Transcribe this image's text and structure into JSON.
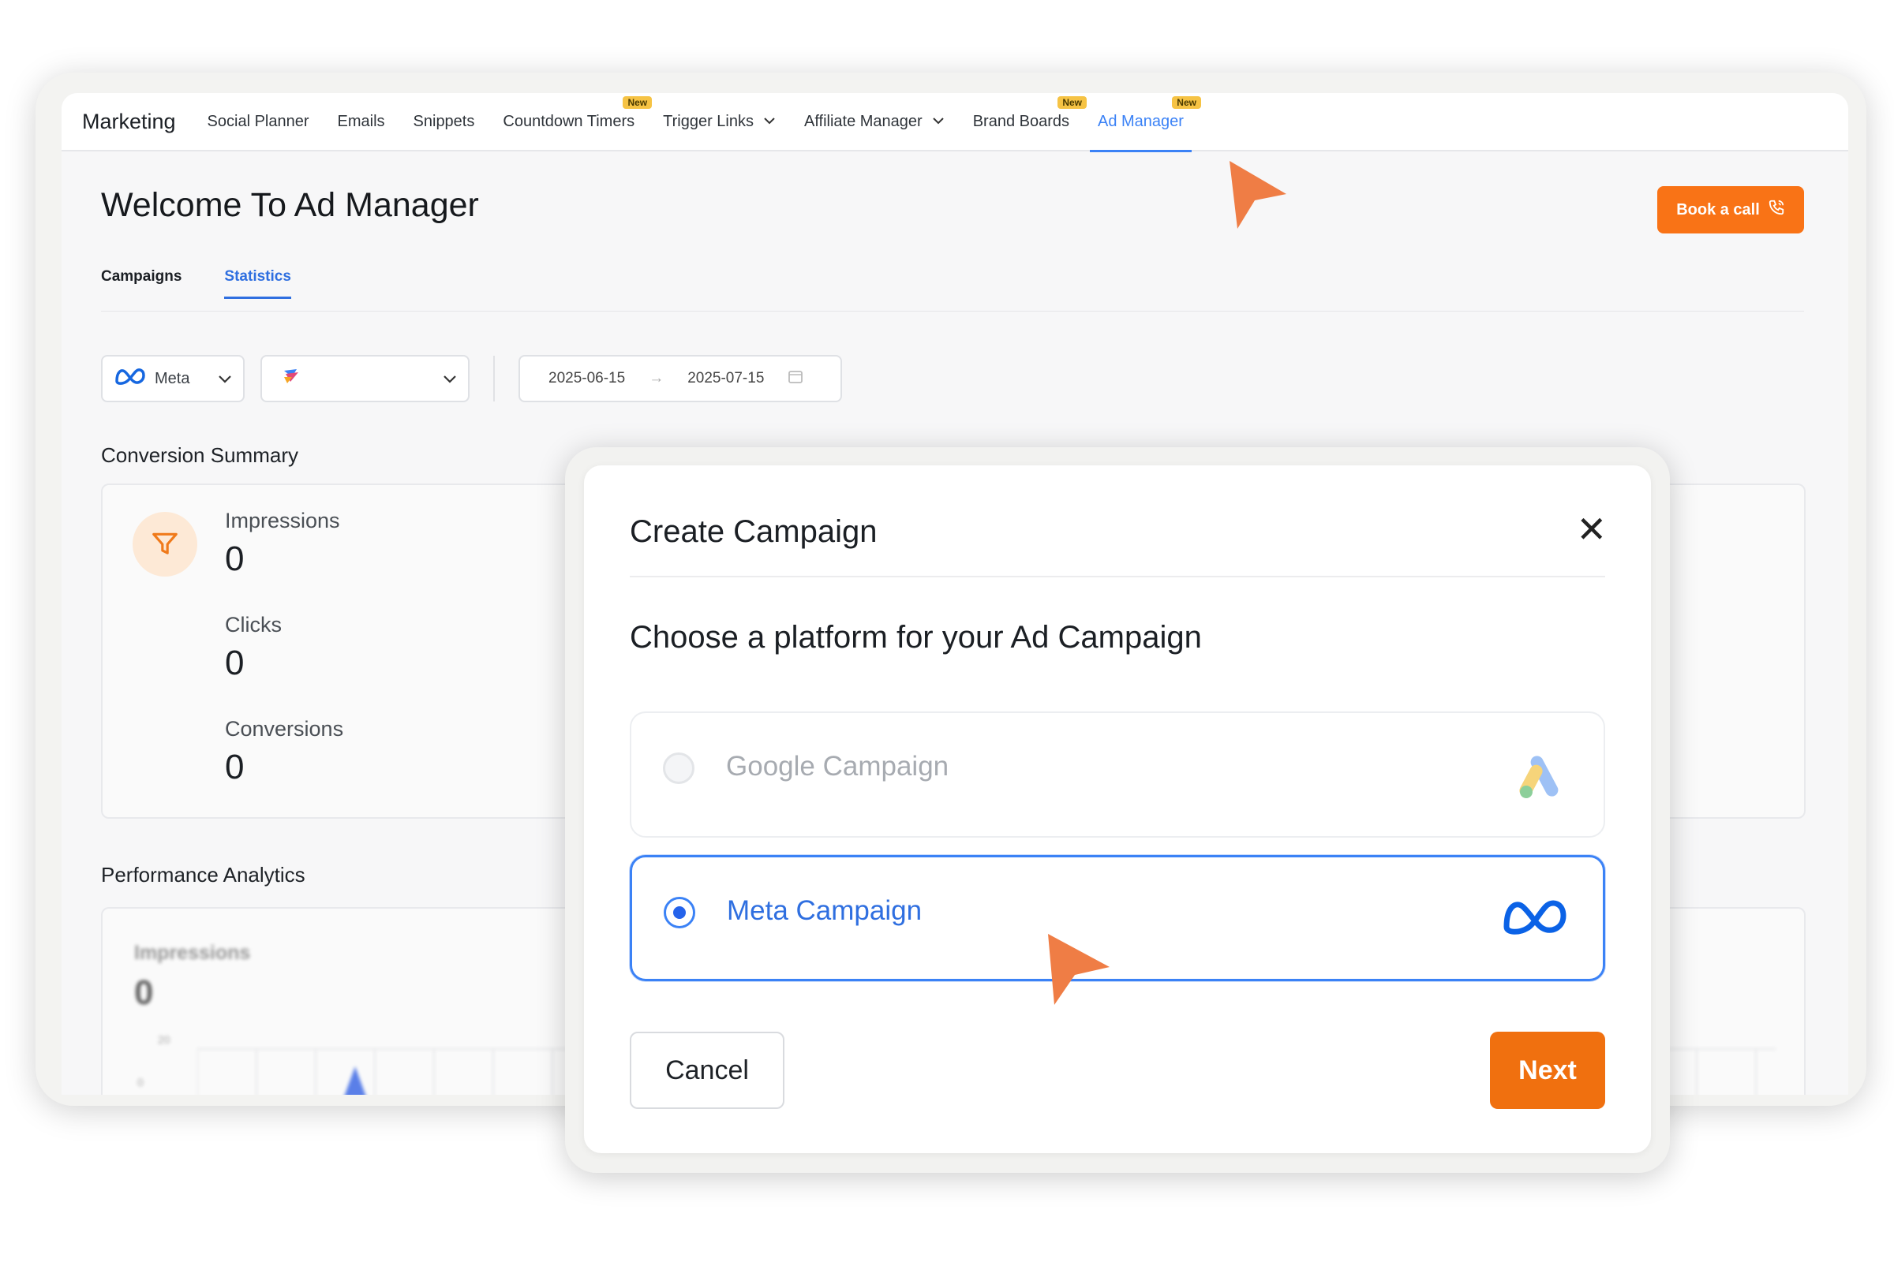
{
  "nav": {
    "brand": "Marketing",
    "items": [
      {
        "label": "Social Planner"
      },
      {
        "label": "Emails"
      },
      {
        "label": "Snippets"
      },
      {
        "label": "Countdown Timers",
        "badge": "New"
      },
      {
        "label": "Trigger Links",
        "dropdown": true
      },
      {
        "label": "Affiliate Manager",
        "dropdown": true
      },
      {
        "label": "Brand Boards",
        "badge": "New"
      },
      {
        "label": "Ad Manager",
        "badge": "New",
        "active": true
      }
    ]
  },
  "page": {
    "title": "Welcome To Ad Manager",
    "book_call": "Book a call",
    "tabs": [
      {
        "label": "Campaigns"
      },
      {
        "label": "Statistics",
        "active": true
      }
    ]
  },
  "filters": {
    "platform": "Meta",
    "account": "",
    "date_from": "2025-06-15",
    "date_to": "2025-07-15",
    "arrow": "→"
  },
  "summary": {
    "title": "Conversion Summary",
    "metrics": [
      {
        "label": "Impressions",
        "value": "0"
      },
      {
        "label": "Clicks",
        "value": "0"
      },
      {
        "label": "Conversions",
        "value": "0"
      }
    ]
  },
  "performance": {
    "title": "Performance Analytics",
    "metric_label": "Impressions",
    "metric_value": "0",
    "tick_top": "20",
    "tick_bottom": "0"
  },
  "modal": {
    "title": "Create Campaign",
    "close": "✕",
    "subtitle": "Choose a platform for your Ad Campaign",
    "options": [
      {
        "label": "Google Campaign",
        "selected": false,
        "icon": "google-ads-icon"
      },
      {
        "label": "Meta Campaign",
        "selected": true,
        "icon": "meta-icon"
      }
    ],
    "cancel": "Cancel",
    "next": "Next"
  },
  "colors": {
    "accent": "#3b82f6",
    "orange": "#f0700f",
    "cursor": "#ef7d45"
  }
}
